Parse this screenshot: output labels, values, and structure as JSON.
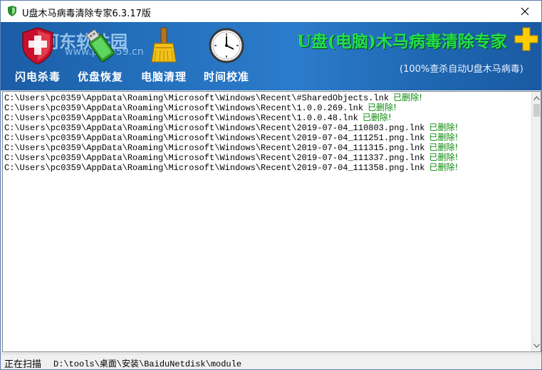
{
  "window": {
    "title": "U盘木马病毒清除专家6.3.17版"
  },
  "toolbar": {
    "items": [
      {
        "label": "闪电杀毒",
        "icon": "shield-icon"
      },
      {
        "label": "优盘恢复",
        "icon": "usb-drive-icon"
      },
      {
        "label": "电脑清理",
        "icon": "broom-icon"
      },
      {
        "label": "时间校准",
        "icon": "clock-icon"
      }
    ]
  },
  "banner": {
    "watermark": "河东软件园",
    "watermark_url": "www.pc0359.cn",
    "brand": "U盘(电脑)木马病毒清除专家",
    "slogan": "(100%查杀自动U盘木马病毒)",
    "accent_color": "#ffcc00",
    "brand_color": "#22e04a"
  },
  "log": {
    "entries": [
      {
        "path": "C:\\Users\\pc0359\\AppData\\Roaming\\Microsoft\\Windows\\Recent\\#SharedObjects.lnk",
        "status": "已删除!"
      },
      {
        "path": "C:\\Users\\pc0359\\AppData\\Roaming\\Microsoft\\Windows\\Recent\\1.0.0.269.lnk",
        "status": "已删除!"
      },
      {
        "path": "C:\\Users\\pc0359\\AppData\\Roaming\\Microsoft\\Windows\\Recent\\1.0.0.48.lnk",
        "status": "已删除!"
      },
      {
        "path": "C:\\Users\\pc0359\\AppData\\Roaming\\Microsoft\\Windows\\Recent\\2019-07-04_110803.png.lnk",
        "status": "已删除!"
      },
      {
        "path": "C:\\Users\\pc0359\\AppData\\Roaming\\Microsoft\\Windows\\Recent\\2019-07-04_111251.png.lnk",
        "status": "已删除!"
      },
      {
        "path": "C:\\Users\\pc0359\\AppData\\Roaming\\Microsoft\\Windows\\Recent\\2019-07-04_111315.png.lnk",
        "status": "已删除!"
      },
      {
        "path": "C:\\Users\\pc0359\\AppData\\Roaming\\Microsoft\\Windows\\Recent\\2019-07-04_111337.png.lnk",
        "status": "已删除!"
      },
      {
        "path": "C:\\Users\\pc0359\\AppData\\Roaming\\Microsoft\\Windows\\Recent\\2019-07-04_111358.png.lnk",
        "status": "已删除!"
      }
    ],
    "status_color": "#0a8a0a"
  },
  "statusbar": {
    "label": "正在扫描",
    "path": "D:\\tools\\桌面\\安装\\BaiduNetdisk\\module"
  }
}
